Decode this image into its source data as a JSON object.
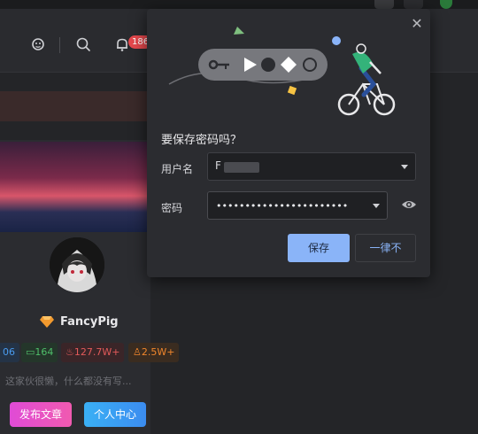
{
  "header": {
    "notification_count": "186"
  },
  "profile": {
    "username": "FancyPig",
    "stats": [
      {
        "value": "06",
        "color": "#4a9cf0"
      },
      {
        "value": "164",
        "color": "#4fbf6a"
      },
      {
        "value": "127.7W+",
        "color": "#e35a5a"
      },
      {
        "value": "2.5W+",
        "color": "#f0862c"
      }
    ],
    "bio": "这家伙很懒，什么都没有写...",
    "publish_label": "发布文章",
    "center_label": "个人中心"
  },
  "dialog": {
    "title": "要保存密码吗？",
    "username_label": "用户名",
    "username_value": "F",
    "password_label": "密码",
    "password_mask": "•••••••••••••••••••••••",
    "save_label": "保存",
    "never_label": "一律不",
    "close_symbol": "✕"
  }
}
